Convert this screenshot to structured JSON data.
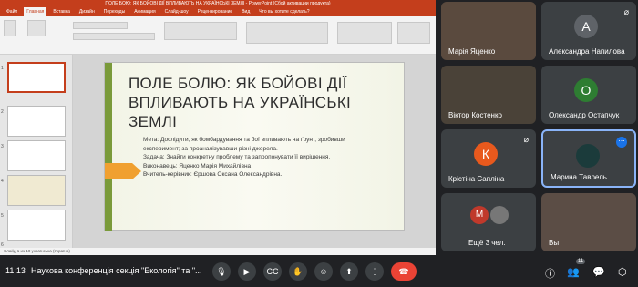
{
  "ppt": {
    "window_title": "ПОЛЕ БОЮ: ЯК БОЙОВІ ДІЇ ВПЛИВАЮТЬ НА УКРАЇНСЬКІ ЗЕМЛІ - PowerPoint (Сбой активации продукта)",
    "tabs": [
      "Файл",
      "Главная",
      "Вставка",
      "Дизайн",
      "Переходы",
      "Анимация",
      "Слайд-шоу",
      "Рецензирование",
      "Вид",
      "Что вы хотите сделать?"
    ],
    "status": "Слайд 1 из 10   українська (Україна)",
    "thumb_numbers": [
      "1",
      "2",
      "3",
      "4",
      "5",
      "6"
    ],
    "slide_title": "ПОЛЕ БОЛЮ: ЯК БОЙОВІ ДІЇ ВПЛИВАЮТЬ НА УКРАЇНСЬКІ ЗЕМЛІ",
    "meta_label": "Мета:",
    "meta_text": "Дослідити, як бомбардування та бої впливають на ґрунт, зробивши експеримент; за проаналізувавши різні джерела.",
    "task_label": "Задача:",
    "task_text": "Знайти конкретну проблему та запропонувати її вирішення.",
    "executor": "Виконавець: Яценко Марія Михайлівна",
    "teacher": "Вчитель-керівник: Єршова Оксана Олександрівна."
  },
  "participants": [
    {
      "name": "Марія Яценко"
    },
    {
      "name": "Александра Напилова",
      "initial": "A"
    },
    {
      "name": "Віктор Костенко"
    },
    {
      "name": "Олександр Остапчук",
      "initial": "О"
    },
    {
      "name": "Крістіна Сапліна",
      "initial": "К"
    },
    {
      "name": "Марина Таврель"
    },
    {
      "name": "Ещё 3 чел.",
      "initial": "M"
    },
    {
      "name": "Вы"
    }
  ],
  "meet": {
    "time": "11:13",
    "meeting_title": "Наукова конференція секція \"Екологія\" та \"...",
    "participant_count": "11"
  },
  "colors": {
    "ppt_red": "#c43e1c",
    "meet_bg": "#202124",
    "tile": "#3c4043",
    "hang": "#ea4335",
    "avatar_k": "#e8591d",
    "avatar_o": "#2e7d32",
    "avatar_a": "#5f6368"
  }
}
